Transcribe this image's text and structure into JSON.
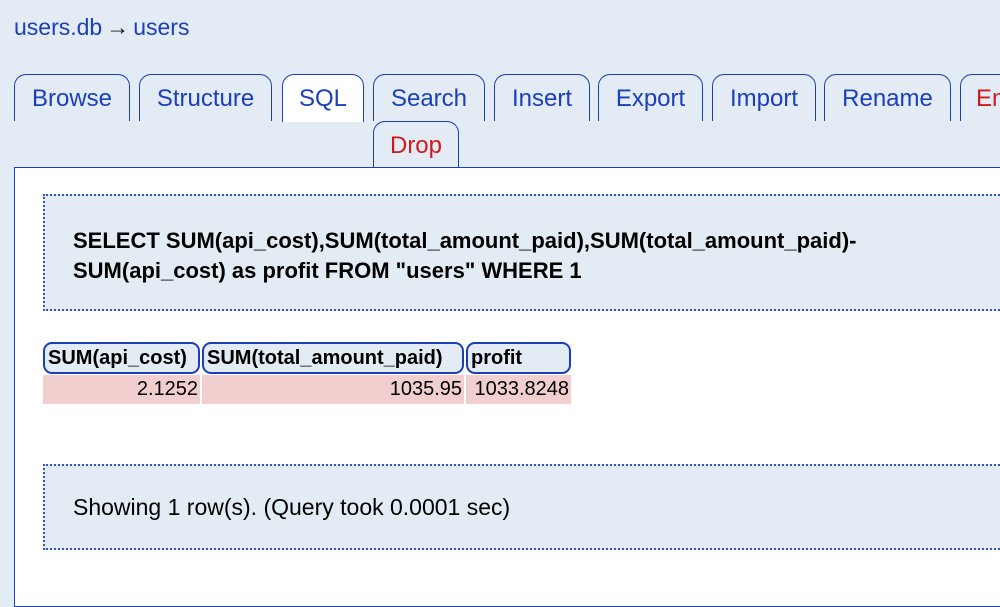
{
  "breadcrumb": {
    "db": "users.db",
    "arrow": "→",
    "table": "users"
  },
  "tabs": {
    "browse": "Browse",
    "structure": "Structure",
    "sql": "SQL",
    "search": "Search",
    "insert": "Insert",
    "export": "Export",
    "import": "Import",
    "rename": "Rename",
    "empty": "Em",
    "drop": "Drop",
    "active": "SQL"
  },
  "query": {
    "text": "SELECT SUM(api_cost),SUM(total_amount_paid),SUM(total_amount_paid)-SUM(api_cost) as profit FROM \"users\" WHERE 1"
  },
  "results": {
    "columns": [
      "SUM(api_cost)",
      "SUM(total_amount_paid)",
      "profit"
    ],
    "rows": [
      [
        "2.1252",
        "1035.95",
        "1033.8248"
      ]
    ]
  },
  "status": {
    "text": "Showing 1 row(s). (Query took 0.0001 sec)"
  },
  "colors": {
    "link": "#1a3fb8",
    "danger": "#d01a1a",
    "background": "#e3ebf5",
    "row": "#f2cfcf"
  }
}
